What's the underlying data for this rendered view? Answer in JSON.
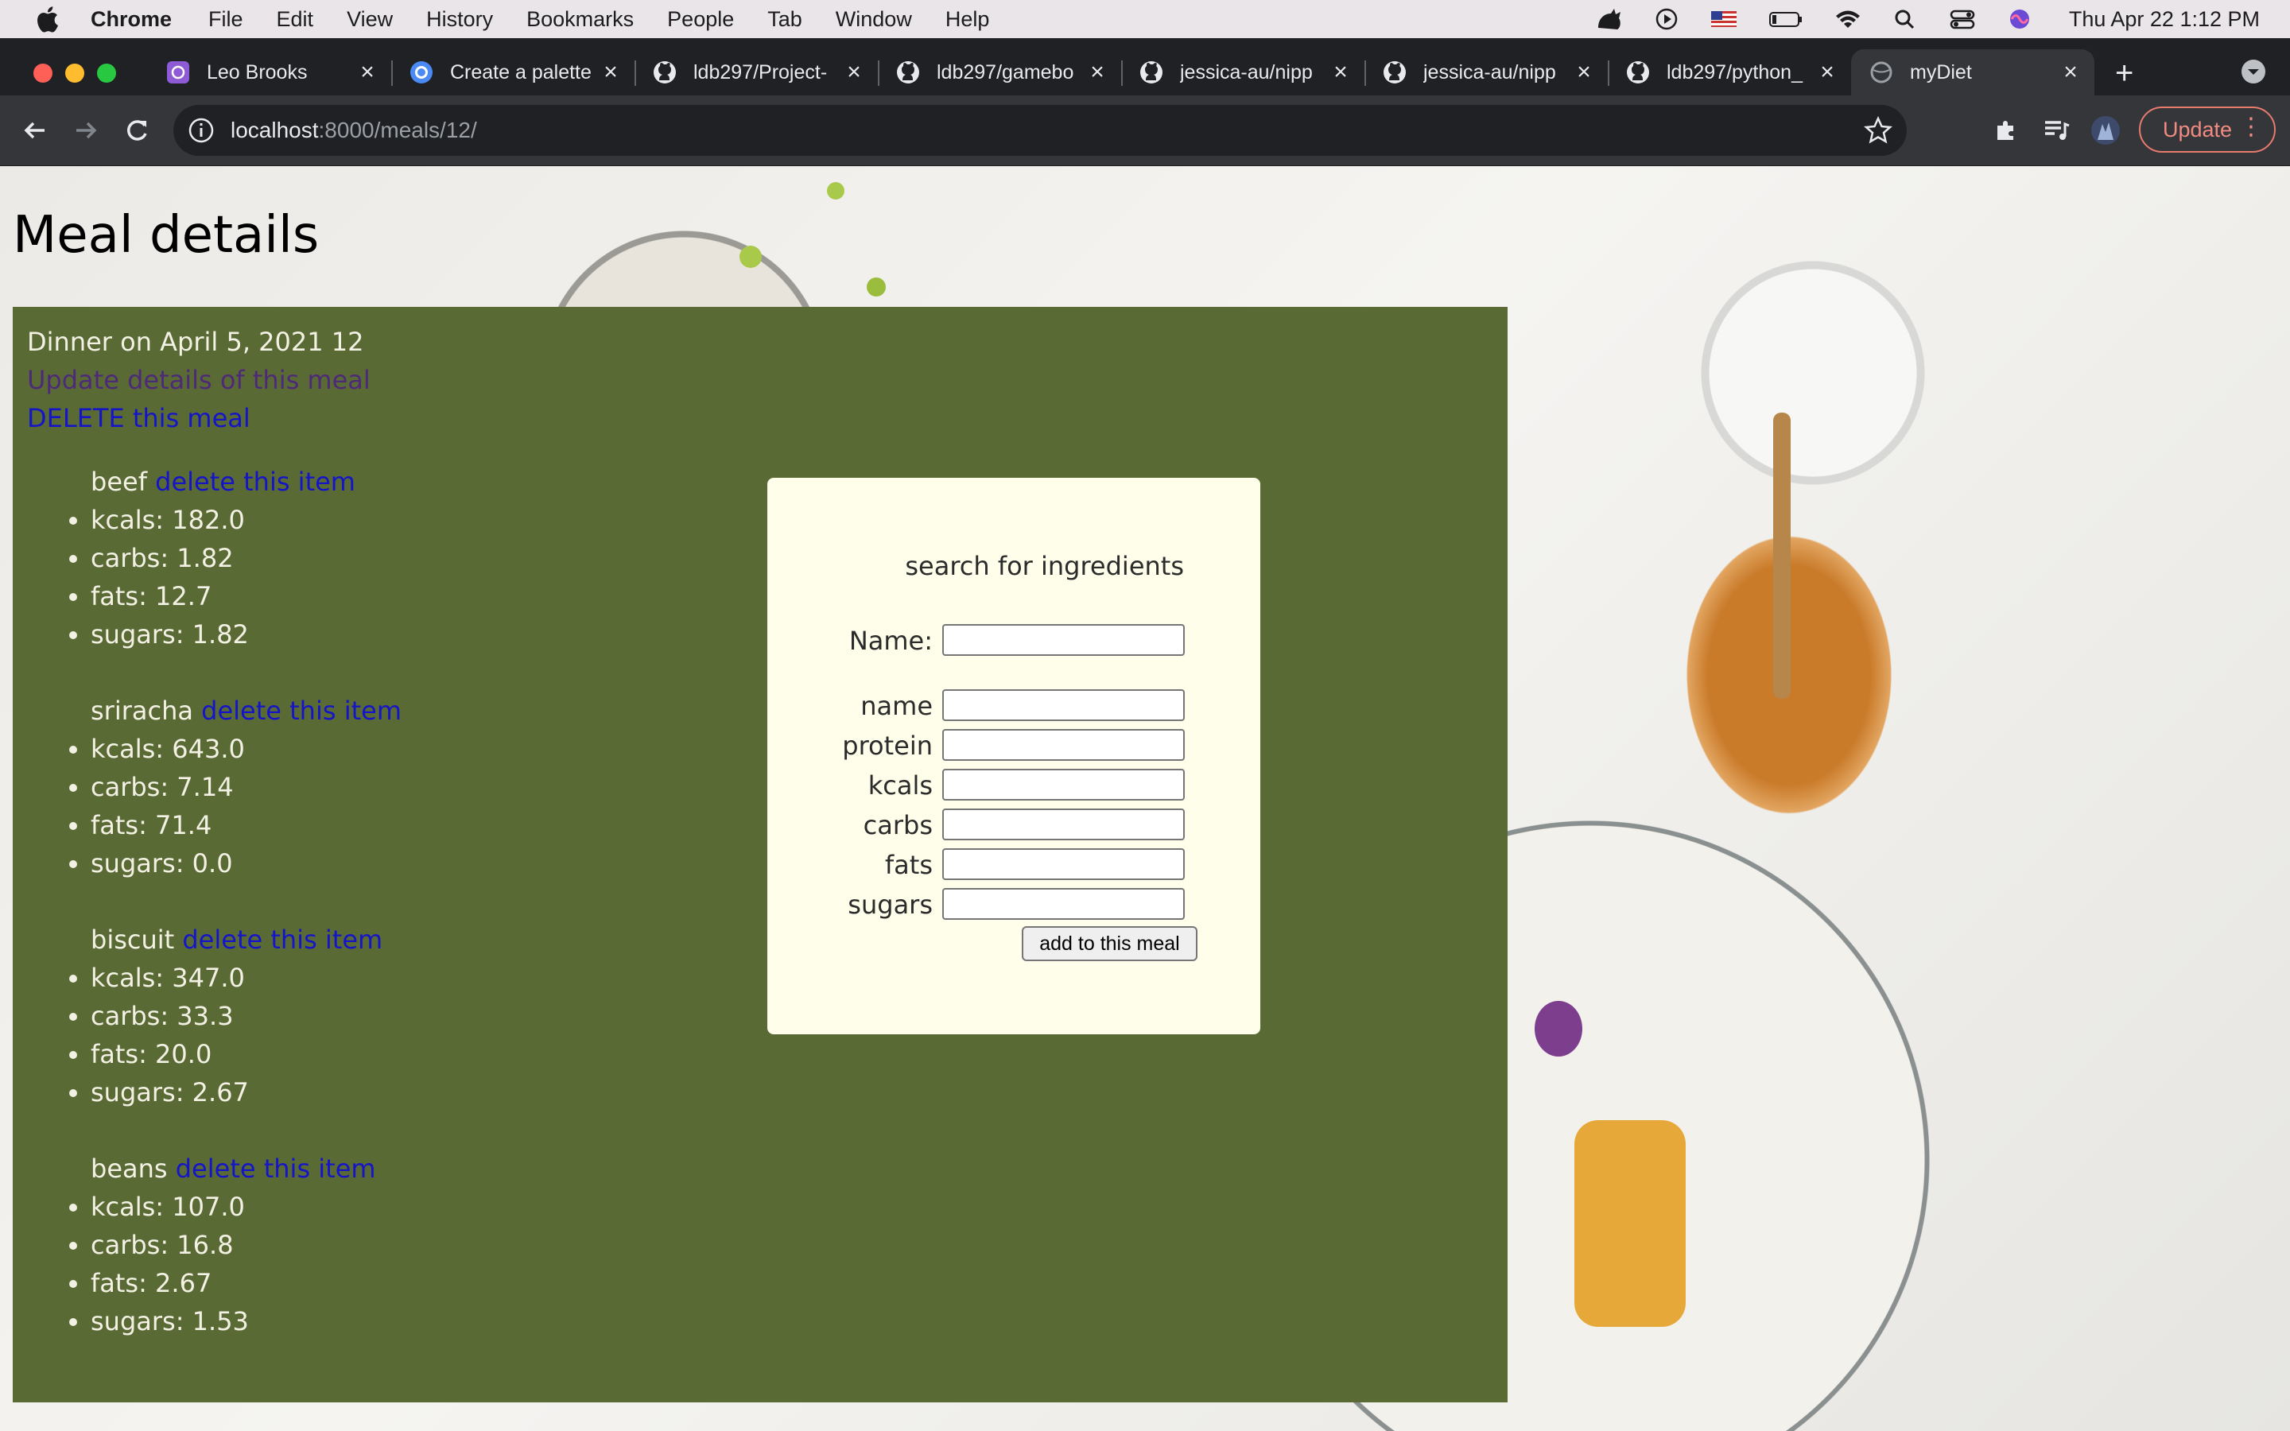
{
  "menubar": {
    "app_name": "Chrome",
    "items": [
      "File",
      "Edit",
      "View",
      "History",
      "Bookmarks",
      "People",
      "Tab",
      "Window",
      "Help"
    ],
    "clock": "Thu Apr 22  1:12 PM"
  },
  "browser": {
    "tabs": [
      {
        "title": "Leo Brooks",
        "icon": "purple-app-icon"
      },
      {
        "title": "Create a palette",
        "icon": "coolors-icon"
      },
      {
        "title": "ldb297/Project-",
        "icon": "github-icon"
      },
      {
        "title": "ldb297/gamebo",
        "icon": "github-icon"
      },
      {
        "title": "jessica-au/nipp",
        "icon": "github-icon"
      },
      {
        "title": "jessica-au/nipp",
        "icon": "github-icon"
      },
      {
        "title": "ldb297/python_",
        "icon": "github-icon"
      },
      {
        "title": "myDiet",
        "icon": "globe-icon",
        "active": true
      }
    ],
    "url_host": "localhost",
    "url_path": ":8000/meals/12/",
    "update_label": "Update"
  },
  "page": {
    "heading": "Meal details",
    "meal_title": "Dinner on April 5, 2021 12",
    "update_link": "Update details of this meal",
    "delete_meal_link": "DELETE this meal",
    "delete_item_label": "delete this item",
    "items": [
      {
        "name": "beef",
        "nutrients": [
          "kcals: 182.0",
          "carbs: 1.82",
          "fats: 12.7",
          "sugars: 1.82"
        ]
      },
      {
        "name": "sriracha",
        "nutrients": [
          "kcals: 643.0",
          "carbs: 7.14",
          "fats: 71.4",
          "sugars: 0.0"
        ]
      },
      {
        "name": "biscuit",
        "nutrients": [
          "kcals: 347.0",
          "carbs: 33.3",
          "fats: 20.0",
          "sugars: 2.67"
        ]
      },
      {
        "name": "beans",
        "nutrients": [
          "kcals: 107.0",
          "carbs: 16.8",
          "fats: 2.67",
          "sugars: 1.53"
        ]
      }
    ],
    "search": {
      "heading": "search for ingredients",
      "name_label": "Name:",
      "name_value": "",
      "fields": [
        "name",
        "protein",
        "kcals",
        "carbs",
        "fats",
        "sugars"
      ],
      "submit_label": "add to this meal"
    }
  },
  "colors": {
    "panel": "#5a6a35",
    "search_box": "#fefeea",
    "link": "#1515c8",
    "visited_link": "#4d2a78"
  }
}
